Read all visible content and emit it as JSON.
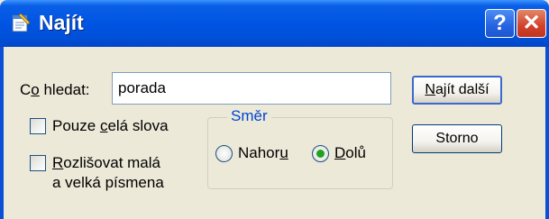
{
  "window": {
    "title": "Najít"
  },
  "titlebar": {
    "help_label": "?",
    "close_label": "✕"
  },
  "search": {
    "label_prefix": "C",
    "label_access": "o",
    "label_suffix": " hledat:",
    "value": "porada"
  },
  "buttons": {
    "find_access": "N",
    "find_suffix": "ajít další",
    "cancel_label": "Storno"
  },
  "options": {
    "whole_word_prefix": "Pouze ",
    "whole_word_access": "c",
    "whole_word_suffix": "elá slova",
    "whole_word_checked": false,
    "case_access": "R",
    "case_line1_suffix": "ozlišovat malá",
    "case_line2": "a velká písmena",
    "case_checked": false
  },
  "direction": {
    "title": "Směr",
    "up_prefix": "Nahor",
    "up_access": "u",
    "down_access": "D",
    "down_suffix": "olů",
    "selected": "Dolů"
  },
  "colors": {
    "titlebar": "#0054e3",
    "dialog_bg": "#ece9d8",
    "group_title": "#0046d5",
    "radio_dot": "#21a121"
  }
}
